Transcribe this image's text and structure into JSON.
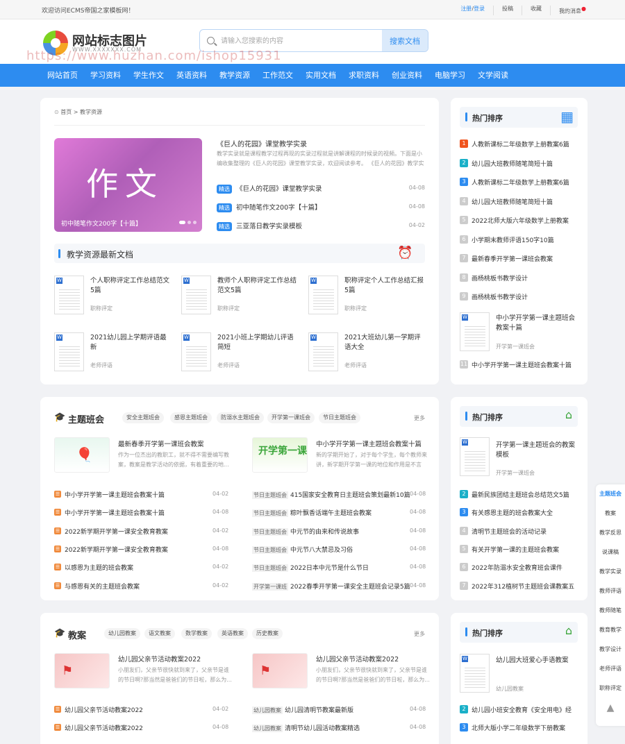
{
  "topbar": {
    "welcome": "欢迎访问ECMS帝国之家模板网！",
    "register": "注册",
    "slash": "/",
    "login": "登录",
    "contribute": "投稿",
    "favorite": "收藏",
    "messages": "我的消息"
  },
  "logo": {
    "title": "网站标志图片",
    "sub": "WWW.XXXXXXX.COM"
  },
  "search": {
    "placeholder": "请输入您搜索的内容",
    "button": "搜索文档"
  },
  "watermark": "https://www.huzhan.com/ishop15931",
  "nav": [
    "网站首页",
    "学习资料",
    "学生作文",
    "英语资料",
    "教学资源",
    "工作范文",
    "实用文档",
    "求职资料",
    "创业资料",
    "电脑学习",
    "文学阅读"
  ],
  "breadcrumb": {
    "home": "首页",
    "sep": ">",
    "current": "教学资源"
  },
  "banner": {
    "big": "作文",
    "caption": "初中随笔作文200字【十篇】"
  },
  "featured": {
    "title": "《巨人的花园》课堂教学实录",
    "desc": "教学实录就是课程教学过程再现的实录过程就是讲解课程的时候录的视频。下面是小编收集整理的《巨人的花园》课堂教学实录，欢迎阅读参考。 《巨人的花园》教学实录..."
  },
  "picks": [
    {
      "tag": "精选",
      "title": "《巨人的花园》课堂教学实录",
      "date": "04-08"
    },
    {
      "tag": "精选",
      "title": "初中随笔作文200字【十篇】",
      "date": "04-08"
    },
    {
      "tag": "精选",
      "title": "三亚落日教学实录模板",
      "date": "04-02"
    }
  ],
  "latest": {
    "title": "教学资源最新文档",
    "docs": [
      {
        "title": "个人职称评定工作总结范文5篇",
        "cat": "职称评定"
      },
      {
        "title": "教师个人职称评定工作总结范文5篇",
        "cat": "职称评定"
      },
      {
        "title": "职称评定个人工作总结汇报5篇",
        "cat": "职称评定"
      },
      {
        "title": "2021幼儿园上学期评语最新",
        "cat": "老师评语"
      },
      {
        "title": "2021小班上学期幼儿评语简短",
        "cat": "老师评语"
      },
      {
        "title": "2021大班幼儿第一学期评语大全",
        "cat": "老师评语"
      }
    ]
  },
  "rank1": {
    "title": "热门排序",
    "items": [
      "人教新课标二年级数学上册教案6篇",
      "幼儿园大班教师随笔简短十篇",
      "人教新课标二年级数学上册教案6篇",
      "幼儿园大班教师随笔简短十篇",
      "2022北师大版六年级数学上册教案",
      "小学期末教师评语150字10篇",
      "最新春季开学第一课班会教案",
      "画杨桃板书教学设计",
      "画杨桃板书教学设计"
    ],
    "nums": [
      "1",
      "2",
      "3",
      "4",
      "5",
      "6",
      "7",
      "8",
      "9",
      "10",
      "11"
    ],
    "doc": {
      "title": "中小学开学第一课主题班会教案十篇",
      "cat": "开学第一课班会"
    },
    "last": "中小学开学第一课主题班会教案十篇"
  },
  "theme": {
    "title": "主题班会",
    "chips": [
      "安全主题班会",
      "感恩主题班会",
      "防溺水主题班会",
      "开学第一课班会",
      "节日主题班会"
    ],
    "more": "更多",
    "feat": [
      {
        "title": "最新春季开学第一课班会教案",
        "desc": "作为一位杰出的教职工，就不得不需要编写教案，教案是教学活动的依据，有着重要的地..."
      },
      {
        "title": "中小学开学第一课主题班会教案十篇",
        "desc": "新的学期开始了，对于每个学生，每个教师来讲，新学期开学第一课的地位和作用是不言而..."
      }
    ],
    "thumb2": "开学第一课",
    "left": [
      {
        "t": "中小学开学第一课主题班会教案十篇",
        "d": "04-02"
      },
      {
        "t": "中小学开学第一课主题班会教案十篇",
        "d": "04-08"
      },
      {
        "t": "2022新学期开学第一课安全教育教案",
        "d": "04-02"
      },
      {
        "t": "2022新学期开学第一课安全教育教案",
        "d": "04-08"
      },
      {
        "t": "以感恩为主题的班会教案",
        "d": "04-02"
      },
      {
        "t": "与感恩有关的主题班会教案",
        "d": "04-02"
      }
    ],
    "right": [
      {
        "c": "节日主题班会",
        "t": "415国家安全教育日主题班会策划最新10篇",
        "d": "04-08"
      },
      {
        "c": "节日主题班会",
        "t": "粽叶飘香话端午主题班会教案",
        "d": "04-08"
      },
      {
        "c": "节日主题班会",
        "t": "中元节的由来和传说故事",
        "d": "04-08"
      },
      {
        "c": "节日主题班会",
        "t": "中元节八大禁忌及习俗",
        "d": "04-08"
      },
      {
        "c": "节日主题班会",
        "t": "2022日本中元节是什么节日",
        "d": "04-08"
      },
      {
        "c": "开学第一课班",
        "t": "2022春季开学第一课安全主题班会记录5篇",
        "d": "04-08"
      }
    ]
  },
  "rank2": {
    "title": "热门排序",
    "doc": {
      "title": "开学第一课主题班会的教案模板",
      "cat": "开学第一课班会"
    },
    "items": [
      "最新民族团结主题班会总结范文5篇",
      "有关感恩主题的班会教案大全",
      "清明节主题班会的活动记录",
      "有关开学第一课的主题班会教案",
      "2022年防溺水安全教育班会课件",
      "2022年312植树节主题班会课教案五"
    ],
    "nums": [
      "2",
      "3",
      "4",
      "5",
      "6",
      "7"
    ]
  },
  "lesson": {
    "title": "教案",
    "chips": [
      "幼儿园教案",
      "语文教案",
      "数学教案",
      "英语教案",
      "历史教案"
    ],
    "more": "更多",
    "feat": [
      {
        "title": "幼儿园父亲节活动教案2022",
        "desc": "小朋友们，父亲节很快就到来了，父亲节是谁的节日啊?那当然是爸爸们的节日啦，那么为..."
      },
      {
        "title": "幼儿园父亲节活动教案2022",
        "desc": "小朋友们，父亲节很快就到来了，父亲节是谁的节日啊?那当然是爸爸们的节日啦，那么为..."
      }
    ],
    "left": [
      {
        "t": "幼儿园父亲节活动教案2022",
        "d": "04-02"
      },
      {
        "t": "幼儿园父亲节活动教案2022",
        "d": "04-08"
      }
    ],
    "right": [
      {
        "c": "幼儿园教案",
        "t": "幼儿园清明节教案最新版",
        "d": "04-08"
      },
      {
        "c": "幼儿园教案",
        "t": "清明节幼儿园活动教案精选",
        "d": "04-08"
      }
    ]
  },
  "rank3": {
    "title": "热门排序",
    "doc": {
      "title": "幼儿园大班爱心手语教案",
      "cat": "幼儿园教案"
    },
    "items": [
      "幼儿园小班安全教育《安全用电》经",
      "北师大版小学二年级数学下册教案"
    ],
    "nums": [
      "2",
      "3"
    ]
  },
  "sidefloat": [
    "主题班会",
    "教案",
    "教学反思",
    "说课稿",
    "教学实录",
    "教师评语",
    "教师随笔",
    "教育教学",
    "教学设计",
    "老师评语",
    "职称评定"
  ]
}
